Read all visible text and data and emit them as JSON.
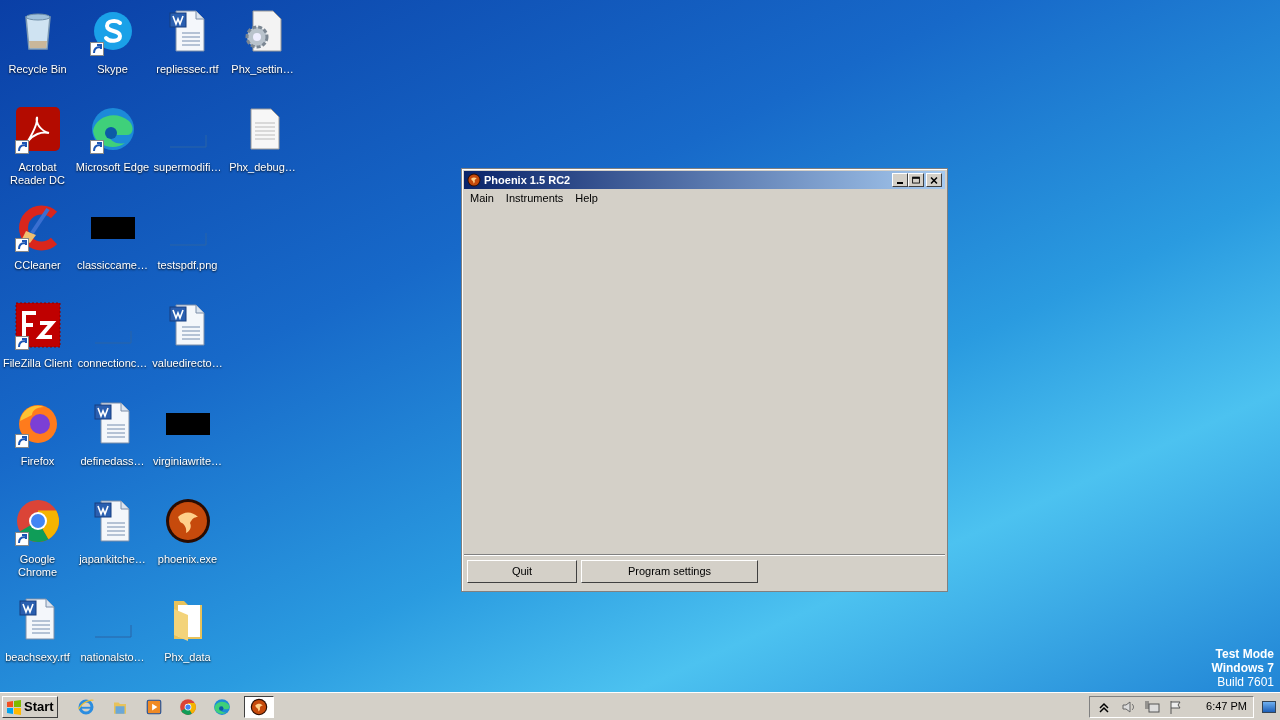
{
  "desktop": {
    "columns": [
      [
        {
          "label": "Recycle Bin",
          "kind": "recycle",
          "shortcut": false
        },
        {
          "label": "Acrobat Reader DC",
          "kind": "pdf",
          "shortcut": true
        },
        {
          "label": "CCleaner",
          "kind": "ccleaner",
          "shortcut": true
        },
        {
          "label": "FileZilla Client",
          "kind": "filezilla",
          "shortcut": true
        },
        {
          "label": "Firefox",
          "kind": "firefox",
          "shortcut": true
        },
        {
          "label": "Google Chrome",
          "kind": "chrome",
          "shortcut": true
        },
        {
          "label": "beachsexy.rtf",
          "kind": "word",
          "shortcut": false
        }
      ],
      [
        {
          "label": "Skype",
          "kind": "skype",
          "shortcut": true
        },
        {
          "label": "Microsoft Edge",
          "kind": "edge",
          "shortcut": true
        },
        {
          "label": "classiccame…",
          "kind": "dark",
          "shortcut": false
        },
        {
          "label": "connectionc…",
          "kind": "blank",
          "shortcut": false
        },
        {
          "label": "definedass…",
          "kind": "word",
          "shortcut": false
        },
        {
          "label": "japankitche…",
          "kind": "word",
          "shortcut": false
        },
        {
          "label": "nationalsto…",
          "kind": "blank",
          "shortcut": false
        }
      ],
      [
        {
          "label": "repliessec.rtf",
          "kind": "word",
          "shortcut": false
        },
        {
          "label": "supermodifi…",
          "kind": "blank",
          "shortcut": false
        },
        {
          "label": "testspdf.png",
          "kind": "blank",
          "shortcut": false
        },
        {
          "label": "valuedirecto…",
          "kind": "word",
          "shortcut": false
        },
        {
          "label": "virginiawrite…",
          "kind": "dark",
          "shortcut": false
        },
        {
          "label": "phoenix.exe",
          "kind": "phoenix",
          "shortcut": false
        },
        {
          "label": "Phx_data",
          "kind": "folder",
          "shortcut": false
        }
      ],
      [
        {
          "label": "Phx_settin…",
          "kind": "settings",
          "shortcut": false
        },
        {
          "label": "Phx_debug…",
          "kind": "text",
          "shortcut": false
        }
      ]
    ]
  },
  "window": {
    "title": "Phoenix 1.5 RC2",
    "menu": [
      "Main",
      "Instruments",
      "Help"
    ],
    "buttons": [
      "Quit",
      "Program settings"
    ]
  },
  "system_notice": [
    "Test Mode",
    "Windows 7",
    "Build 7601"
  ],
  "taskbar": {
    "start": "Start",
    "items": [
      {
        "kind": "ie",
        "selected": false
      },
      {
        "kind": "explorer",
        "selected": false
      },
      {
        "kind": "media",
        "selected": false
      },
      {
        "kind": "chrome",
        "selected": false
      },
      {
        "kind": "edge",
        "selected": false
      },
      {
        "kind": "phoenix",
        "selected": true
      }
    ],
    "clock": "6:47 PM"
  }
}
